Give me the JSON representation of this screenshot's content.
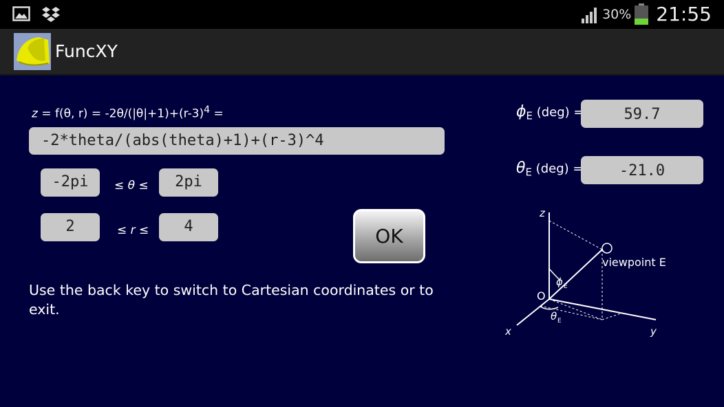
{
  "status_bar": {
    "battery_pct": "30%",
    "time": "21:55",
    "icons": [
      "gallery-icon",
      "dropbox-icon",
      "signal-icon",
      "battery-icon"
    ]
  },
  "app": {
    "title": "FuncXY"
  },
  "formula": {
    "label_lhs": "z",
    "label_rest": " = f(θ, r) = -2θ/(|θ|+1)+(r-3)",
    "label_exp": "4",
    "label_tail": " =",
    "value": "-2*theta/(abs(theta)+1)+(r-3)^4"
  },
  "theta_range": {
    "min": "-2pi",
    "symbol": "≤ θ ≤",
    "max": "2pi"
  },
  "r_range": {
    "min": "2",
    "symbol": "≤ r ≤",
    "max": "4"
  },
  "ok_button": "OK",
  "instructions": "Use the back key to switch to Cartesian coordinates or to exit.",
  "phi_e": {
    "symbol": "ϕ",
    "sub": "E",
    "unit": " (deg) =",
    "value": "59.7"
  },
  "theta_e": {
    "symbol": "θ",
    "sub": "E",
    "unit": " (deg) =",
    "value": "-21.0"
  },
  "diagram": {
    "z": "z",
    "x": "x",
    "y": "y",
    "origin": "O",
    "viewpoint": "viewpoint E",
    "phi": "ϕ",
    "theta": "θ",
    "sub": "E"
  },
  "colors": {
    "background": "#00003c",
    "field": "#c8c8c8",
    "status_bar": "#000000",
    "action_bar": "#222222"
  }
}
